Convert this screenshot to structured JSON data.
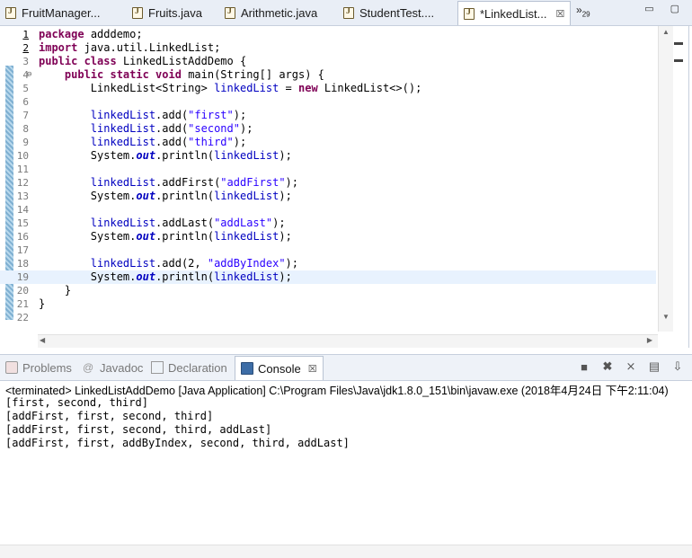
{
  "editor_tabs": [
    {
      "label": "FruitManager...",
      "active": false
    },
    {
      "label": "Fruits.java",
      "active": false
    },
    {
      "label": "Arithmetic.java",
      "active": false
    },
    {
      "label": "StudentTest....",
      "active": false
    },
    {
      "label": "*LinkedList...",
      "active": true
    }
  ],
  "tab_close_glyph": "☒",
  "more_tabs": {
    "glyph": "»",
    "count": "29"
  },
  "code_lines": [
    {
      "n": "1",
      "parts": [
        [
          "kw",
          "package"
        ],
        [
          "",
          "adddemo;"
        ]
      ]
    },
    {
      "n": "2",
      "parts": [
        [
          "kw",
          "import"
        ],
        [
          "",
          "java.util.LinkedList;"
        ]
      ]
    },
    {
      "n": "3",
      "parts": [
        [
          "kw",
          "public class"
        ],
        [
          "",
          "LinkedListAddDemo {"
        ]
      ]
    },
    {
      "n": "4",
      "parts": [
        [
          "",
          "    "
        ],
        [
          "kw",
          "public static void"
        ],
        [
          "",
          "main(String[] args) {"
        ]
      ]
    },
    {
      "n": "5",
      "parts": [
        [
          "",
          "        LinkedList<String> "
        ],
        [
          "fld",
          "linkedList"
        ],
        [
          "",
          " = "
        ],
        [
          "kw",
          "new"
        ],
        [
          "",
          " LinkedList<>();"
        ]
      ]
    },
    {
      "n": "6",
      "parts": []
    },
    {
      "n": "7",
      "parts": [
        [
          "",
          "        "
        ],
        [
          "fld",
          "linkedList"
        ],
        [
          "",
          ".add("
        ],
        [
          "str",
          "\"first\""
        ],
        [
          "",
          ");"
        ]
      ]
    },
    {
      "n": "8",
      "parts": [
        [
          "",
          "        "
        ],
        [
          "fld",
          "linkedList"
        ],
        [
          "",
          ".add("
        ],
        [
          "str",
          "\"second\""
        ],
        [
          "",
          ");"
        ]
      ]
    },
    {
      "n": "9",
      "parts": [
        [
          "",
          "        "
        ],
        [
          "fld",
          "linkedList"
        ],
        [
          "",
          ".add("
        ],
        [
          "str",
          "\"third\""
        ],
        [
          "",
          ");"
        ]
      ]
    },
    {
      "n": "10",
      "parts": [
        [
          "",
          "        System."
        ],
        [
          "st",
          "out"
        ],
        [
          "",
          ".println("
        ],
        [
          "fld",
          "linkedList"
        ],
        [
          "",
          ");"
        ]
      ]
    },
    {
      "n": "11",
      "parts": []
    },
    {
      "n": "12",
      "parts": [
        [
          "",
          "        "
        ],
        [
          "fld",
          "linkedList"
        ],
        [
          "",
          ".addFirst("
        ],
        [
          "str",
          "\"addFirst\""
        ],
        [
          "",
          ");"
        ]
      ]
    },
    {
      "n": "13",
      "parts": [
        [
          "",
          "        System."
        ],
        [
          "st",
          "out"
        ],
        [
          "",
          ".println("
        ],
        [
          "fld",
          "linkedList"
        ],
        [
          "",
          ");"
        ]
      ]
    },
    {
      "n": "14",
      "parts": []
    },
    {
      "n": "15",
      "parts": [
        [
          "",
          "        "
        ],
        [
          "fld",
          "linkedList"
        ],
        [
          "",
          ".addLast("
        ],
        [
          "str",
          "\"addLast\""
        ],
        [
          "",
          ");"
        ]
      ]
    },
    {
      "n": "16",
      "parts": [
        [
          "",
          "        System."
        ],
        [
          "st",
          "out"
        ],
        [
          "",
          ".println("
        ],
        [
          "fld",
          "linkedList"
        ],
        [
          "",
          ");"
        ]
      ]
    },
    {
      "n": "17",
      "parts": []
    },
    {
      "n": "18",
      "parts": [
        [
          "",
          "        "
        ],
        [
          "fld",
          "linkedList"
        ],
        [
          "",
          ".add(2, "
        ],
        [
          "str",
          "\"addByIndex\""
        ],
        [
          "",
          ");"
        ]
      ]
    },
    {
      "n": "19",
      "parts": [
        [
          "",
          "        System."
        ],
        [
          "st",
          "out"
        ],
        [
          "",
          ".println("
        ],
        [
          "fld",
          "linkedList"
        ],
        [
          "",
          ");"
        ]
      ]
    },
    {
      "n": "20",
      "parts": [
        [
          "",
          "    }"
        ]
      ]
    },
    {
      "n": "21",
      "parts": [
        [
          "",
          "}"
        ]
      ]
    },
    {
      "n": "22",
      "parts": []
    }
  ],
  "view_tabs": [
    {
      "label": "Problems",
      "active": false
    },
    {
      "label": "Javadoc",
      "active": false
    },
    {
      "label": "Declaration",
      "active": false
    },
    {
      "label": "Console",
      "active": true
    }
  ],
  "console": {
    "terminated": "<terminated> LinkedListAddDemo [Java Application] C:\\Program Files\\Java\\jdk1.8.0_151\\bin\\javaw.exe (2018年4月24日 下午2:11:04)",
    "output": [
      "[first, second, third]",
      "[addFirst, first, second, third]",
      "[addFirst, first, second, third, addLast]",
      "[addFirst, first, addByIndex, second, third, addLast]"
    ]
  },
  "colors": {
    "keyword": "#7f0055",
    "field": "#0000c0",
    "string": "#2a00ff",
    "current_line": "#e8f2fe"
  }
}
